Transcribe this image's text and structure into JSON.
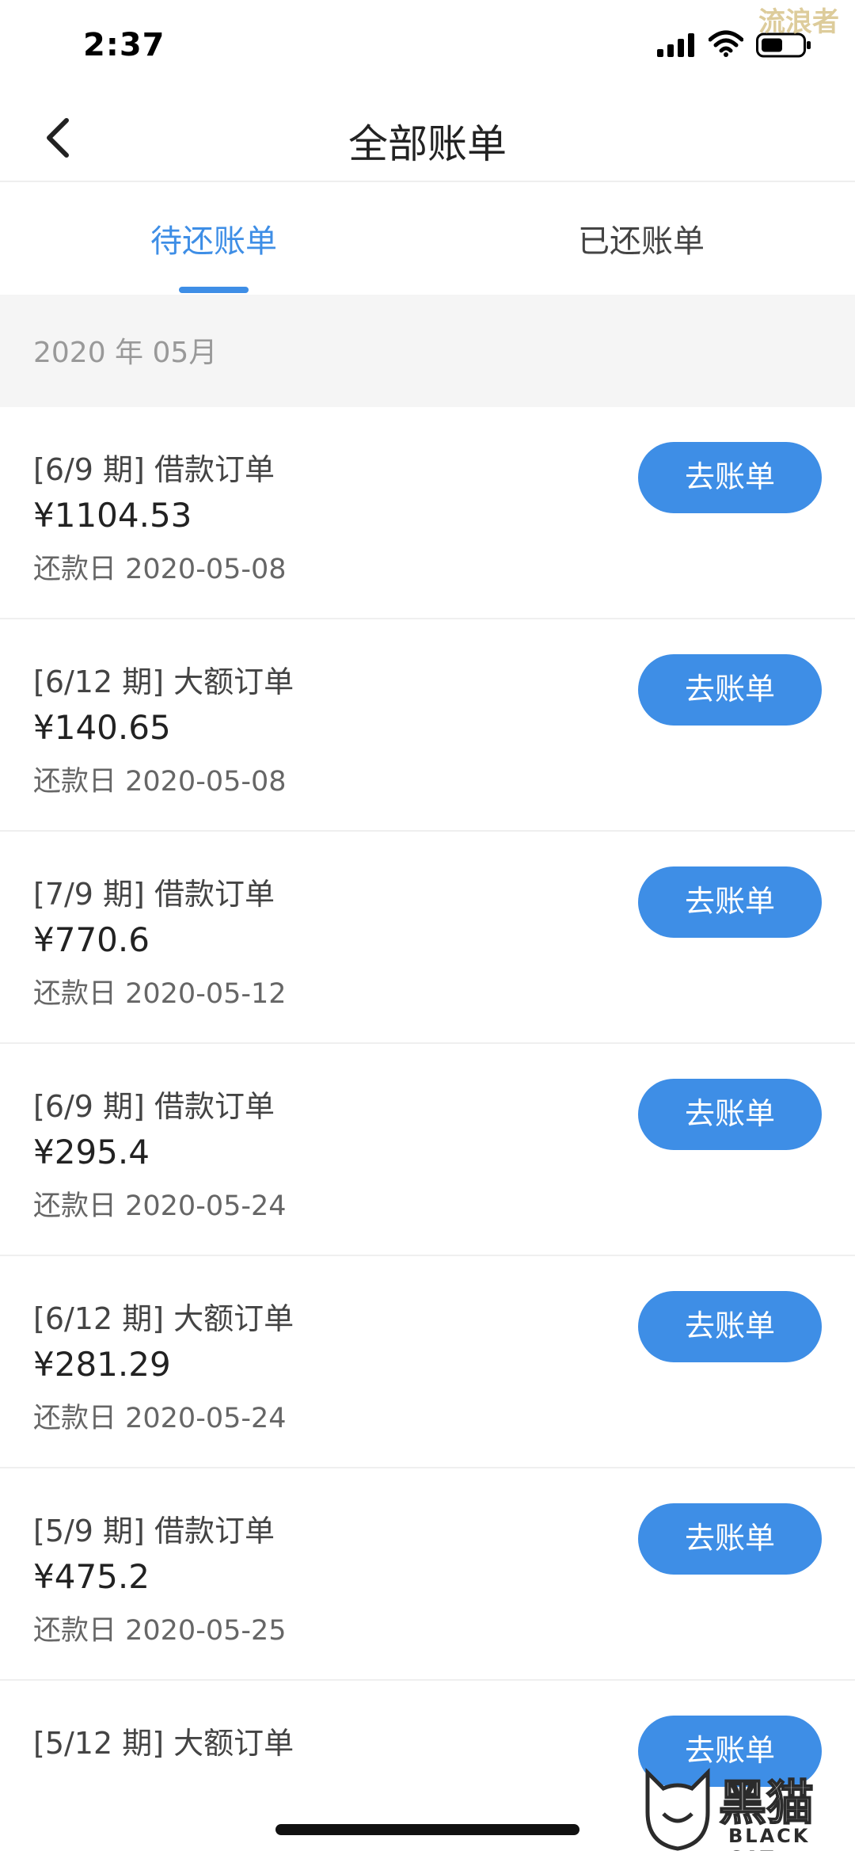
{
  "status_bar": {
    "time": "2:37",
    "watermark": "流浪者"
  },
  "nav": {
    "title": "全部账单"
  },
  "tabs": [
    {
      "label": "待还账单",
      "active": true
    },
    {
      "label": "已还账单",
      "active": false
    }
  ],
  "month": "2020 年 05月",
  "bills": [
    {
      "title": "[6/9 期] 借款订单",
      "amount": "¥1104.53",
      "due": "还款日 2020-05-08",
      "button": "去账单"
    },
    {
      "title": "[6/12 期] 大额订单",
      "amount": "¥140.65",
      "due": "还款日 2020-05-08",
      "button": "去账单"
    },
    {
      "title": "[7/9 期] 借款订单",
      "amount": "¥770.6",
      "due": "还款日 2020-05-12",
      "button": "去账单"
    },
    {
      "title": "[6/9 期] 借款订单",
      "amount": "¥295.4",
      "due": "还款日 2020-05-24",
      "button": "去账单"
    },
    {
      "title": "[6/12 期] 大额订单",
      "amount": "¥281.29",
      "due": "还款日 2020-05-24",
      "button": "去账单"
    },
    {
      "title": "[5/9 期] 借款订单",
      "amount": "¥475.2",
      "due": "还款日 2020-05-25",
      "button": "去账单"
    },
    {
      "title": "[5/12 期] 大额订单",
      "amount": "",
      "due": "",
      "button": "去账单"
    }
  ],
  "watermark_bottom": {
    "cn": "黑猫",
    "en": "BLACK CAT"
  },
  "colors": {
    "accent": "#3e8ee6",
    "background_gray": "#f5f5f5"
  }
}
